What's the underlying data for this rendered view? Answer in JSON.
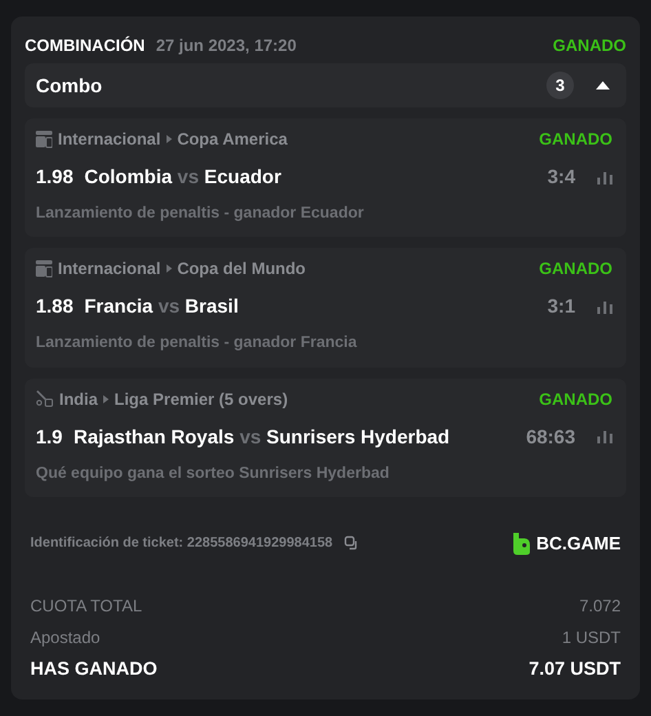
{
  "header": {
    "type": "COMBINACIÓN",
    "datetime": "27 jun 2023, 17:20",
    "status": "GANADO"
  },
  "combo": {
    "label": "Combo",
    "count": "3",
    "expanded": true
  },
  "legs": [
    {
      "kind": "fifa",
      "category": "Internacional",
      "league": "Copa America",
      "status": "GANADO",
      "odds": "1.98",
      "home": "Colombia",
      "vs": "vs",
      "away": "Ecuador",
      "score": "3:4",
      "market": "Lanzamiento de penaltis - ganador Ecuador"
    },
    {
      "kind": "fifa",
      "category": "Internacional",
      "league": "Copa del Mundo",
      "status": "GANADO",
      "odds": "1.88",
      "home": "Francia",
      "vs": "vs",
      "away": "Brasil",
      "score": "3:1",
      "market": "Lanzamiento de penaltis - ganador Francia"
    },
    {
      "kind": "cricket",
      "category": "India",
      "league": "Liga Premier (5 overs)",
      "status": "GANADO",
      "odds": "1.9",
      "home": "Rajasthan Royals",
      "vs": "vs",
      "away": "Sunrisers Hyderbad",
      "score": "68:63",
      "market": "Qué equipo gana el sorteo Sunrisers Hyderbad"
    }
  ],
  "ticket": {
    "label": "Identificación de ticket: 2285586941929984158",
    "brand": "BC.GAME"
  },
  "totals": [
    {
      "kind": "muted",
      "label": "CUOTA TOTAL",
      "value": "7.072"
    },
    {
      "kind": "muted",
      "label": "Apostado",
      "value": "1 USDT"
    },
    {
      "kind": "strong",
      "label": "HAS GANADO",
      "value": "7.07 USDT"
    }
  ]
}
